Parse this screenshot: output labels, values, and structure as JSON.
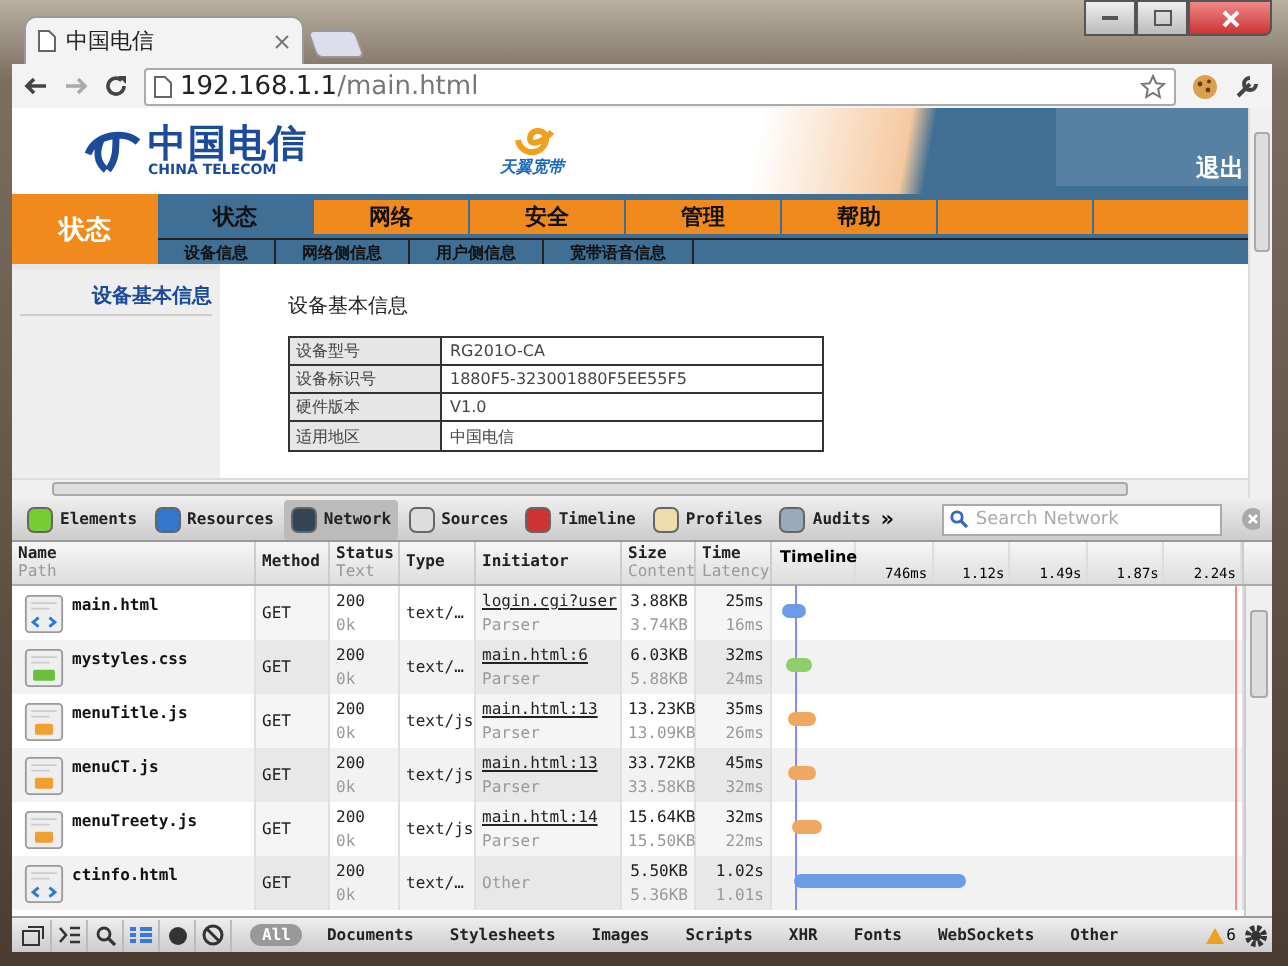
{
  "browser": {
    "tab_title": "中国电信",
    "url_host": "192.168.1.1",
    "url_path": "/main.html"
  },
  "header": {
    "logo_cn": "中国电信",
    "logo_en": "CHINA TELECOM",
    "brand": "天翼宽带",
    "logout": "退出"
  },
  "section": "状态",
  "nav": [
    {
      "label": "状态",
      "selected": true
    },
    {
      "label": "网络",
      "selected": false
    },
    {
      "label": "安全",
      "selected": false
    },
    {
      "label": "管理",
      "selected": false
    },
    {
      "label": "帮助",
      "selected": false
    },
    {
      "selected": false
    },
    {
      "selected": false
    }
  ],
  "subnav": [
    "设备信息",
    "网络侧信息",
    "用户侧信息",
    "宽带语音信息"
  ],
  "sidebar": [
    {
      "label": "设备基本信息",
      "selected": true
    }
  ],
  "content_title": "设备基本信息",
  "info_rows": [
    {
      "label": "设备型号",
      "value": "RG201O-CA"
    },
    {
      "label": "设备标识号",
      "value": "1880F5-323001880F5EE55F5"
    },
    {
      "label": "硬件版本",
      "value": "V1.0"
    },
    {
      "label": "适用地区",
      "value": "中国电信"
    }
  ],
  "devtools": {
    "panels": [
      {
        "label": "Elements",
        "selected": false
      },
      {
        "label": "Resources",
        "selected": false
      },
      {
        "label": "Network",
        "selected": true
      },
      {
        "label": "Sources",
        "selected": false
      },
      {
        "label": "Timeline",
        "selected": false
      },
      {
        "label": "Profiles",
        "selected": false
      },
      {
        "label": "Audits",
        "selected": false
      }
    ],
    "more": "»",
    "search_placeholder": "Search Network",
    "columns": [
      {
        "title": "Name",
        "sub": "Path"
      },
      {
        "title": "Method"
      },
      {
        "title": "Status",
        "sub": "Text"
      },
      {
        "title": "Type"
      },
      {
        "title": "Initiator"
      },
      {
        "title": "Size",
        "sub": "Content"
      },
      {
        "title": "Time",
        "sub": "Latency"
      },
      {
        "title": "Timeline"
      }
    ],
    "ticks": [
      "746ms",
      "1.12s",
      "1.49s",
      "1.87s",
      "2.24s"
    ],
    "rows": [
      {
        "kind": "html",
        "name": "main.html",
        "method": "GET",
        "status": "200",
        "status_text": "0k",
        "type": "text/…",
        "initiator": "login.cgi?user",
        "initiator_link": true,
        "initiator_sub": "Parser",
        "size": "3.88KB",
        "content": "3.74KB",
        "time": "25ms",
        "latency": "16ms",
        "color": "#6c9be8"
      },
      {
        "kind": "css",
        "name": "mystyles.css",
        "method": "GET",
        "status": "200",
        "status_text": "0k",
        "type": "text/…",
        "initiator": "main.html:6",
        "initiator_link": true,
        "initiator_sub": "Parser",
        "size": "6.03KB",
        "content": "5.88KB",
        "time": "32ms",
        "latency": "24ms",
        "color": "#8fcf6a"
      },
      {
        "kind": "js",
        "name": "menuTitle.js",
        "method": "GET",
        "status": "200",
        "status_text": "0k",
        "type": "text/js",
        "initiator": "main.html:13",
        "initiator_link": true,
        "initiator_sub": "Parser",
        "size": "13.23KB",
        "content": "13.09KB",
        "time": "35ms",
        "latency": "26ms",
        "color": "#f0a860"
      },
      {
        "kind": "js",
        "name": "menuCT.js",
        "method": "GET",
        "status": "200",
        "status_text": "0k",
        "type": "text/js",
        "initiator": "main.html:13",
        "initiator_link": true,
        "initiator_sub": "Parser",
        "size": "33.72KB",
        "content": "33.58KB",
        "time": "45ms",
        "latency": "32ms",
        "color": "#f0a860"
      },
      {
        "kind": "js",
        "name": "menuTreety.js",
        "method": "GET",
        "status": "200",
        "status_text": "0k",
        "type": "text/js",
        "initiator": "main.html:14",
        "initiator_link": true,
        "initiator_sub": "Parser",
        "size": "15.64KB",
        "content": "15.50KB",
        "time": "32ms",
        "latency": "22ms",
        "color": "#f0a860"
      },
      {
        "kind": "html",
        "name": "ctinfo.html",
        "method": "GET",
        "status": "200",
        "status_text": "0k",
        "type": "text/…",
        "initiator": "Other",
        "initiator_link": false,
        "size": "5.50KB",
        "content": "5.36KB",
        "time": "1.02s",
        "latency": "1.01s",
        "color": "#6c9be8"
      }
    ],
    "filters": [
      {
        "label": "All",
        "selected": true
      },
      {
        "label": "Documents",
        "selected": false
      },
      {
        "label": "Stylesheets",
        "selected": false
      },
      {
        "label": "Images",
        "selected": false
      },
      {
        "label": "Scripts",
        "selected": false
      },
      {
        "label": "XHR",
        "selected": false
      },
      {
        "label": "Fonts",
        "selected": false
      },
      {
        "label": "WebSockets",
        "selected": false
      },
      {
        "label": "Other",
        "selected": false
      }
    ],
    "warnings": "6"
  }
}
